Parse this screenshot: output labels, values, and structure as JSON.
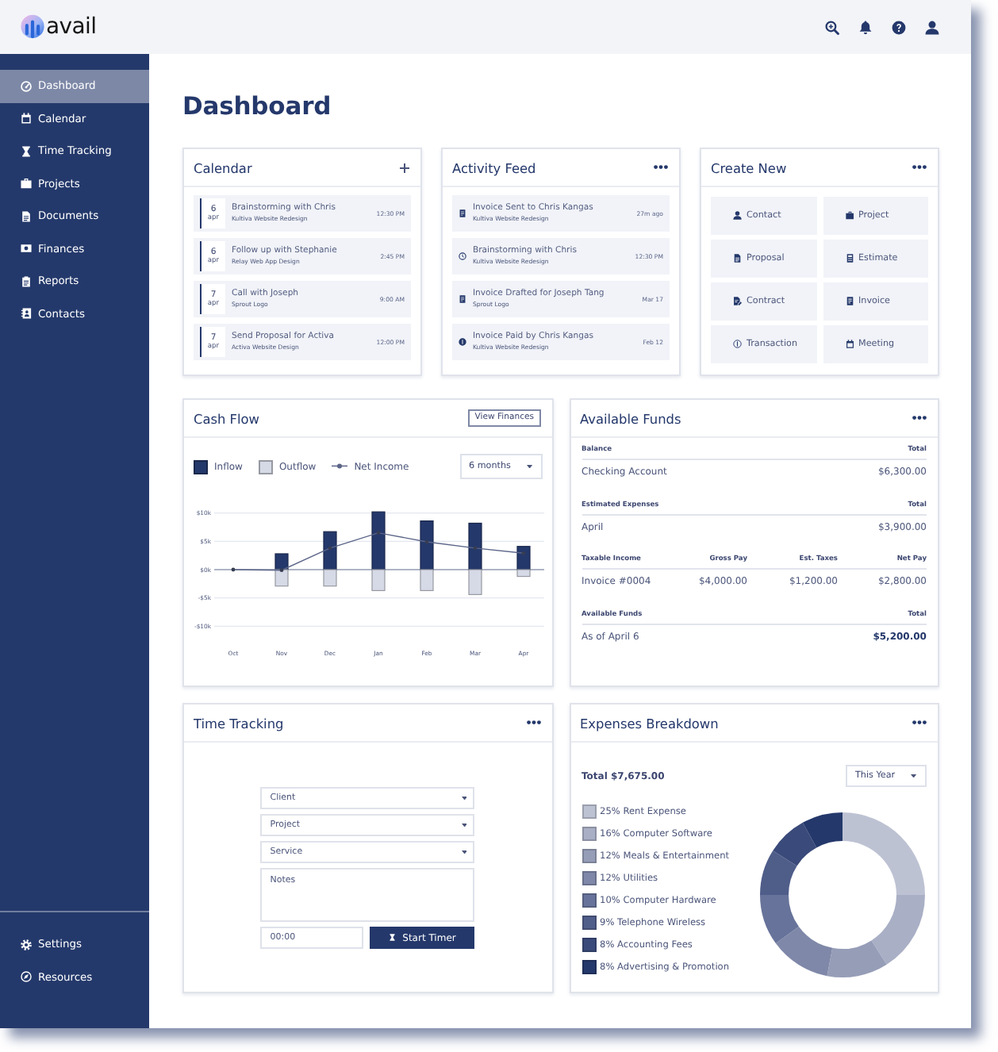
{
  "top_bar": {
    "logo": "avail"
  },
  "sidebar": {
    "items": [
      {
        "label": "Dashboard",
        "selected": true
      },
      {
        "label": "Calendar",
        "selected": false
      },
      {
        "label": "Time Tracking",
        "selected": false
      },
      {
        "label": "Projects",
        "selected": false
      },
      {
        "label": "Documents",
        "selected": false
      },
      {
        "label": "Finances",
        "selected": false
      },
      {
        "label": "Reports",
        "selected": false
      },
      {
        "label": "Contacts",
        "selected": false
      }
    ],
    "footer_items": [
      {
        "label": "Settings",
        "selected": false
      },
      {
        "label": "Resources",
        "selected": false
      }
    ]
  },
  "page_title": "Dashboard",
  "calendar": {
    "title": "Calendar",
    "events": [
      {
        "day": "6",
        "month": "apr",
        "title": "Brainstorming with Chris",
        "project": "Kultiva Website Redesign",
        "time": "12:30 PM"
      },
      {
        "day": "6",
        "month": "apr",
        "title": "Follow up with Stephanie",
        "project": "Relay Web App Design",
        "time": "2:45 PM"
      },
      {
        "day": "7",
        "month": "apr",
        "title": "Call with Joseph",
        "project": "Sprout Logo",
        "time": "9:00 AM"
      },
      {
        "day": "7",
        "month": "apr",
        "title": "Send Proposal for Activa",
        "project": "Activa Website Design",
        "time": "12:00 PM"
      }
    ]
  },
  "activity_feed": {
    "title": "Activity Feed",
    "items": [
      {
        "kind": "invoice",
        "title": "Invoice Sent to Chris Kangas",
        "project": "Kultiva Website Redesign",
        "time": "27m ago"
      },
      {
        "kind": "meeting",
        "title": "Brainstorming with Chris",
        "project": "Kultiva Website Redesign",
        "time": "12:30 PM"
      },
      {
        "kind": "invoice",
        "title": "Invoice Drafted for Joseph Tang",
        "project": "Sprout Logo",
        "time": "Mar 17"
      },
      {
        "kind": "payment",
        "title": "Invoice Paid by Chris Kangas",
        "project": "Kultiva Website Redesign",
        "time": "Feb 12"
      }
    ]
  },
  "create_new": {
    "title": "Create New",
    "buttons": [
      "Contact",
      "Project",
      "Proposal",
      "Estimate",
      "Contract",
      "Invoice",
      "Transaction",
      "Meeting"
    ]
  },
  "cash_flow": {
    "title": "Cash Flow",
    "button": "View Finances",
    "range": "6 months",
    "chart_data": {
      "type": "bar",
      "categories": [
        "Oct",
        "Nov",
        "Dec",
        "Jan",
        "Feb",
        "Mar",
        "Apr"
      ],
      "series": [
        {
          "name": "Inflow",
          "color": "#24386b",
          "values": [
            0,
            2.8,
            6.7,
            10.2,
            8.6,
            8.2,
            4.1
          ]
        },
        {
          "name": "Outflow",
          "color": "#d6dae6",
          "values": [
            0,
            -2.9,
            -2.9,
            -3.7,
            -3.7,
            -4.4,
            -1.2
          ]
        },
        {
          "name": "Net Income",
          "type": "line",
          "color": "#5b6588",
          "values": [
            0,
            -0.1,
            3.8,
            6.5,
            4.9,
            3.8,
            2.9
          ]
        }
      ],
      "stacked": true,
      "ylim": [
        -10.5,
        10.5
      ],
      "yticks": [
        {
          "value": 10,
          "label": "$10k"
        },
        {
          "value": 5,
          "label": "$5k"
        },
        {
          "value": 0,
          "label": "$0k"
        },
        {
          "value": -5,
          "label": "-$5k"
        },
        {
          "value": -10,
          "label": "-$10k"
        }
      ]
    }
  },
  "available_funds": {
    "title": "Available Funds",
    "sections": [
      {
        "kind": "detail",
        "columns": [
          "Balance",
          "Total"
        ],
        "rows": [
          [
            "Checking Account",
            "$6,300.00"
          ]
        ]
      },
      {
        "kind": "detail",
        "columns": [
          "Estimated Expenses",
          "Total"
        ],
        "rows": [
          [
            "April",
            "$3,900.00"
          ]
        ]
      },
      {
        "kind": "detail",
        "columns": [
          "Taxable Income",
          "Gross Pay",
          "Est. Taxes",
          "Net Pay"
        ],
        "rows": [
          [
            "Invoice #0004",
            "$4,000.00",
            "$1,200.00",
            "$2,800.00"
          ]
        ]
      },
      {
        "kind": "summary",
        "columns": [
          "Available Funds",
          "Total"
        ],
        "rows": [
          [
            "As of April 6",
            "$5,200.00"
          ]
        ]
      }
    ]
  },
  "time_tracking": {
    "title": "Time Tracking",
    "fields": [
      {
        "kind": "select",
        "placeholder": "Client"
      },
      {
        "kind": "select",
        "placeholder": "Project"
      },
      {
        "kind": "select",
        "placeholder": "Service"
      },
      {
        "kind": "textarea",
        "placeholder": "Notes"
      }
    ],
    "timer": {
      "placeholder": "00:00"
    },
    "start_button": "Start Timer"
  },
  "expenses_breakdown": {
    "title": "Expenses Breakdown",
    "total": "Total $7,675.00",
    "period": "This Year",
    "chart_data": {
      "type": "donut",
      "categories": [
        "25% Rent Expense",
        "16% Computer Software",
        "12% Meals & Entertainment",
        "12% Utilities",
        "10% Computer Hardware",
        "9% Telephone Wireless",
        "8% Accounting Fees",
        "8% Advertising & Promotion"
      ],
      "values": [
        25,
        16,
        12,
        12,
        10,
        9,
        8,
        8
      ],
      "colors": [
        "#bdc2d3",
        "#a9afc5",
        "#969db7",
        "#7f88a8",
        "#67739a",
        "#4f5d89",
        "#3a4a7a",
        "#24386b"
      ]
    }
  }
}
